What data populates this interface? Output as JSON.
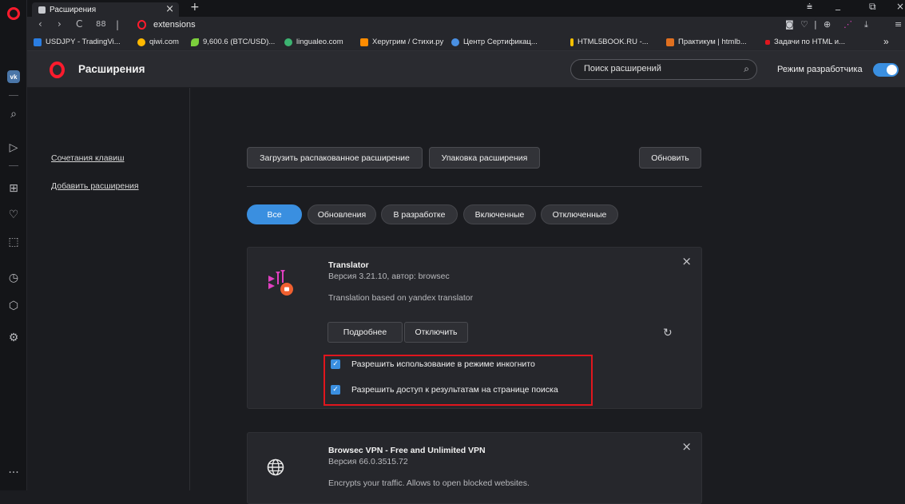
{
  "tab": {
    "title": "Расширения",
    "close": "×",
    "new_tab": "+"
  },
  "window_controls": {
    "filter": "⩧",
    "minimize": "_",
    "restore": "⧉",
    "close": "×"
  },
  "address": {
    "back": "‹",
    "forward": "›",
    "reload": "C",
    "speed_dial": "88",
    "separator": "|",
    "url": "extensions"
  },
  "address_right": {
    "camera": "◙",
    "heart": "♡",
    "sep": "|",
    "vpn": "⊕",
    "download": "⤓",
    "menu": "≡"
  },
  "bookmarks": [
    {
      "label": "USDJPY - TradingVi...",
      "color": "#2a7de1"
    },
    {
      "label": "qiwi.com",
      "color": "#ffb800"
    },
    {
      "label": "9,600.6 (BTC/USD)...",
      "color": "#7ccf3c"
    },
    {
      "label": "lingualeo.com",
      "color": "#3cb371"
    },
    {
      "label": "Херугрим / Стихи.ру",
      "color": "#ff8c00"
    },
    {
      "label": "Центр Сертификац...",
      "color": "#4a90e2"
    },
    {
      "label": "HTML5BOOK.RU -...",
      "color": "#f5c000"
    },
    {
      "label": "Практикум | htmlb...",
      "color": "#e07020"
    },
    {
      "label": "Задачи по HTML и...",
      "color": "#e0161d"
    }
  ],
  "bookmarks_more": "»",
  "sidebar_icons": {
    "vk": "vk",
    "search": "⌕",
    "send": "▷",
    "grid": "⊞",
    "heart": "♡",
    "chat": "⬚",
    "history": "◷",
    "cube": "⬡",
    "settings": "⚙",
    "more": "···"
  },
  "header": {
    "title": "Расширения",
    "search_placeholder": "Поиск расширений",
    "search_icon": "⌕",
    "dev_mode_label": "Режим разработчика",
    "dev_mode_on": true,
    "accent": "#3a8fe0"
  },
  "left_nav": {
    "shortcuts": "Сочетания клавиш",
    "add_extensions": "Добавить расширения"
  },
  "toolbar": {
    "load_unpacked": "Загрузить распакованное расширение",
    "pack": "Упаковка расширения",
    "update": "Обновить"
  },
  "filters": [
    "Все",
    "Обновления",
    "В разработке",
    "Включенные",
    "Отключенные"
  ],
  "extensions": [
    {
      "name": "Translator",
      "version": "Версия 3.21.10, автор: browsec",
      "description": "Translation based on yandex translator",
      "details_label": "Подробнее",
      "disable_label": "Отключить",
      "reload": "↻",
      "close": "×",
      "options": [
        {
          "label": "Разрешить использование в режиме инкогнито",
          "checked": true
        },
        {
          "label": "Разрешить доступ к результатам на странице поиска",
          "checked": true
        }
      ],
      "check": "✓"
    },
    {
      "name": "Browsec VPN - Free and Unlimited VPN",
      "version": "Версия 66.0.3515.72",
      "description": "Encrypts your traffic. Allows to open blocked websites.",
      "close": "×"
    }
  ]
}
